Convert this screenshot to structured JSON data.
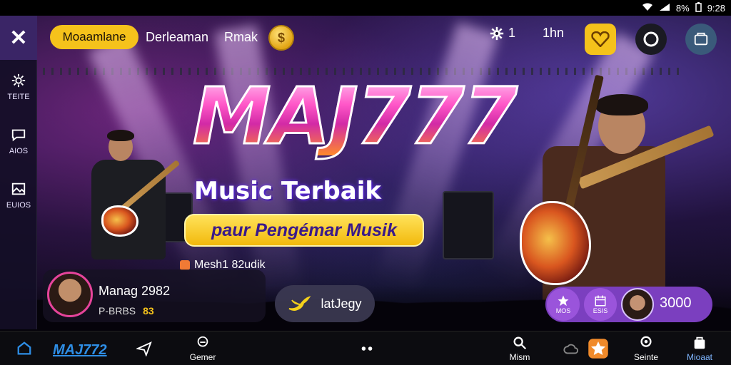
{
  "status_bar": {
    "battery": "8%",
    "time": "9:28"
  },
  "left_rail": {
    "items": [
      {
        "icon": "gear-icon",
        "label": "TEITE"
      },
      {
        "icon": "chat-bubble-icon",
        "label": "AIOS"
      },
      {
        "icon": "image-icon",
        "label": "EUIOS"
      }
    ]
  },
  "top_bar": {
    "pill_label": "Moaamlane",
    "text1": "Derleaman",
    "text2": "Rmak",
    "settings_count": "1",
    "time_label": "1hn"
  },
  "hero": {
    "title": "MAJ777",
    "subtitle": "Music Terbaik",
    "tagline": "paur Pengémar Musik",
    "small_label": "Mesh1 82udik"
  },
  "profile": {
    "name": "Manag 2982",
    "sub": "P-BRBS",
    "badge": "83"
  },
  "bird_pill": {
    "label": "latJegy"
  },
  "right_cluster": {
    "item1_label": "MOS",
    "item2_label": "ESIS",
    "score": "3000"
  },
  "bottom_nav": {
    "logo": "MAJ772",
    "items": [
      {
        "icon": "home-icon",
        "label": ""
      },
      {
        "icon": "send-icon",
        "label": ""
      },
      {
        "icon": "game-icon",
        "label": "Gemer"
      },
      {
        "icon": "dots-icon",
        "label": ""
      },
      {
        "icon": "search-icon",
        "label": "Mism"
      },
      {
        "icon": "cloud-icon",
        "label": ""
      },
      {
        "icon": "star-icon",
        "label": ""
      },
      {
        "icon": "profile-icon",
        "label": "Seinte"
      },
      {
        "icon": "bag-icon",
        "label": "Mioaat"
      }
    ]
  },
  "colors": {
    "accent_yellow": "#f5c21b",
    "accent_purple": "#7b3fbf",
    "accent_pink": "#e6449b",
    "logo_blue": "#2e8ee6"
  }
}
